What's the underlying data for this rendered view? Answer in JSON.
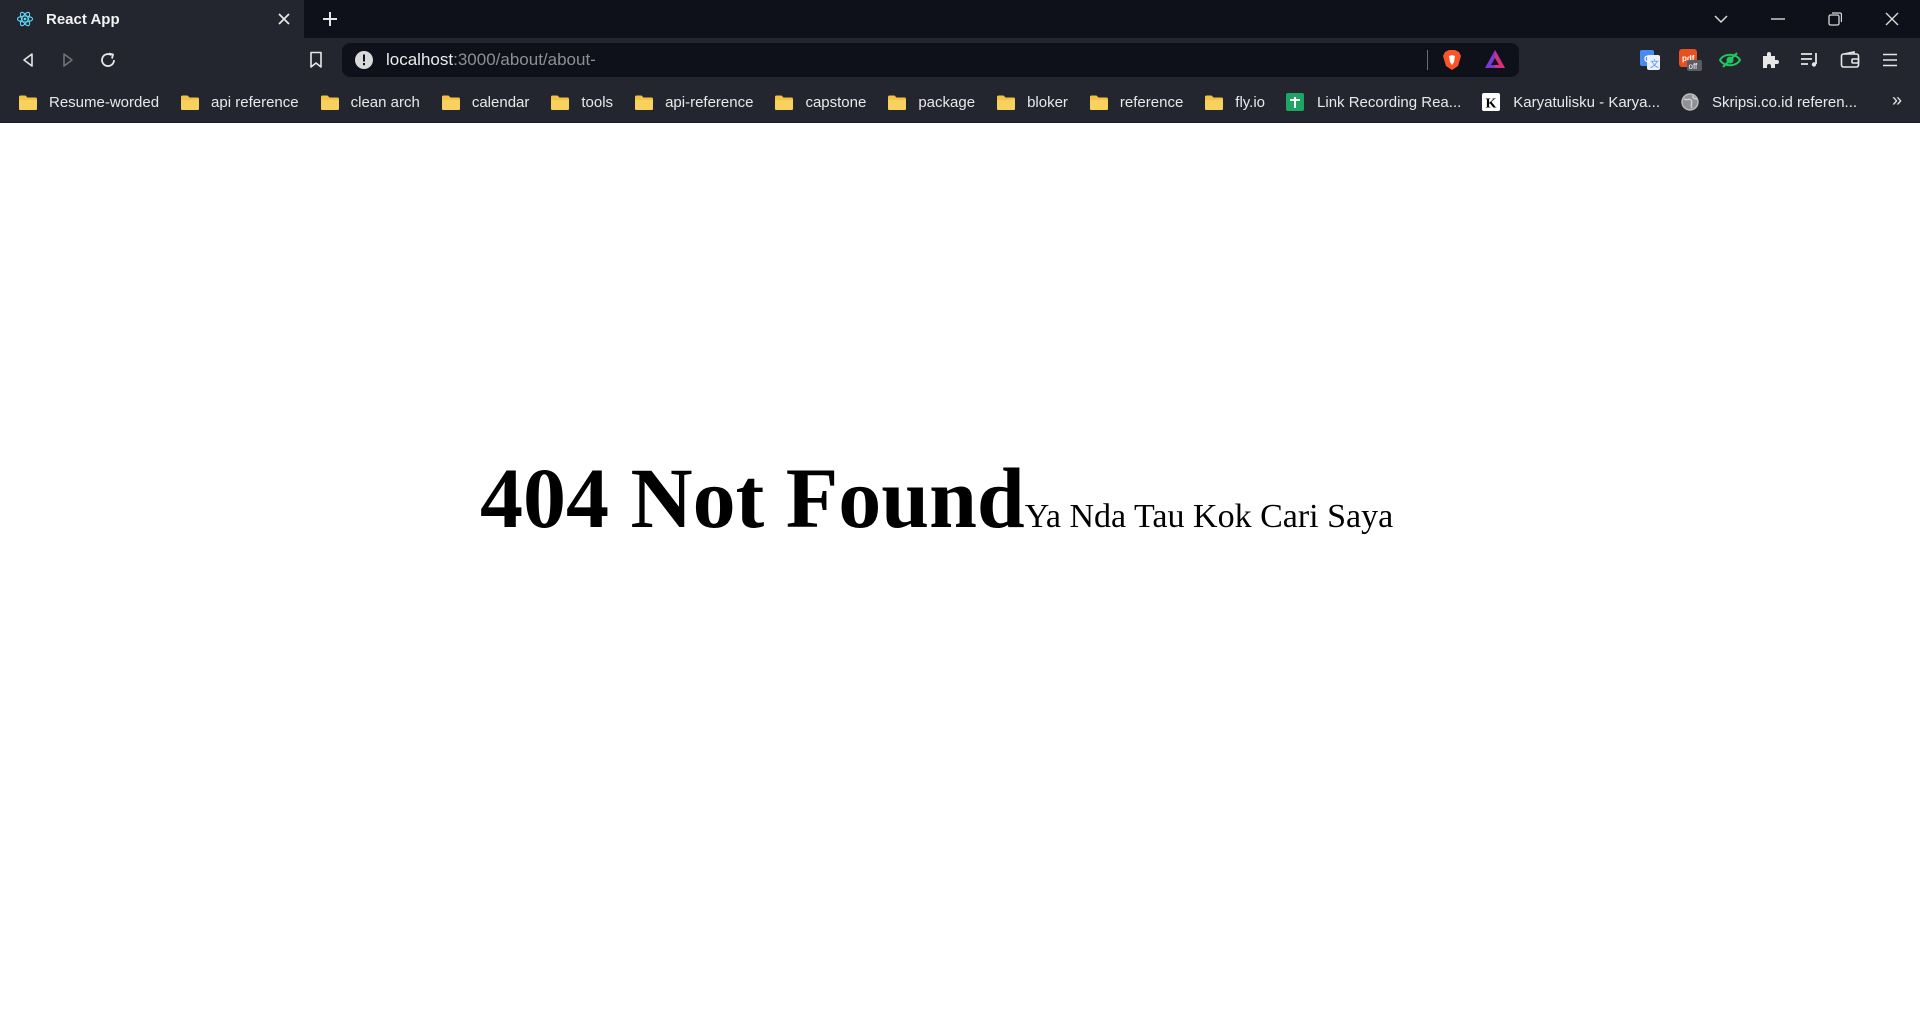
{
  "tab": {
    "title": "React App",
    "favicon": "react-logo-icon"
  },
  "url": {
    "host": "localhost",
    "rest": ":3000/about/about-"
  },
  "bookmarks": [
    {
      "label": "Resume-worded",
      "icon": "folder-icon"
    },
    {
      "label": "api reference",
      "icon": "folder-icon"
    },
    {
      "label": "clean arch",
      "icon": "folder-icon"
    },
    {
      "label": "calendar",
      "icon": "folder-icon"
    },
    {
      "label": "tools",
      "icon": "folder-icon"
    },
    {
      "label": "api-reference",
      "icon": "folder-icon"
    },
    {
      "label": "capstone",
      "icon": "folder-icon"
    },
    {
      "label": "package",
      "icon": "folder-icon"
    },
    {
      "label": "bloker",
      "icon": "folder-icon"
    },
    {
      "label": "reference",
      "icon": "folder-icon"
    },
    {
      "label": "fly.io",
      "icon": "folder-icon"
    },
    {
      "label": "Link Recording Rea...",
      "icon": "google-sheets-icon"
    },
    {
      "label": "Karyatulisku - Karya...",
      "icon": "k-site-icon"
    },
    {
      "label": "Skripsi.co.id referen...",
      "icon": "globe-icon"
    }
  ],
  "bookmarks_overflow": "»",
  "ext_badge": "off",
  "page": {
    "heading": "404 Not Found",
    "subtext": "Ya Nda Tau Kok Cari Saya"
  },
  "colors": {
    "tabbar_bg": "#0f111a",
    "toolbar_bg": "#24262f",
    "folder": "#f5c342",
    "brave_orange": "#fb542b"
  }
}
